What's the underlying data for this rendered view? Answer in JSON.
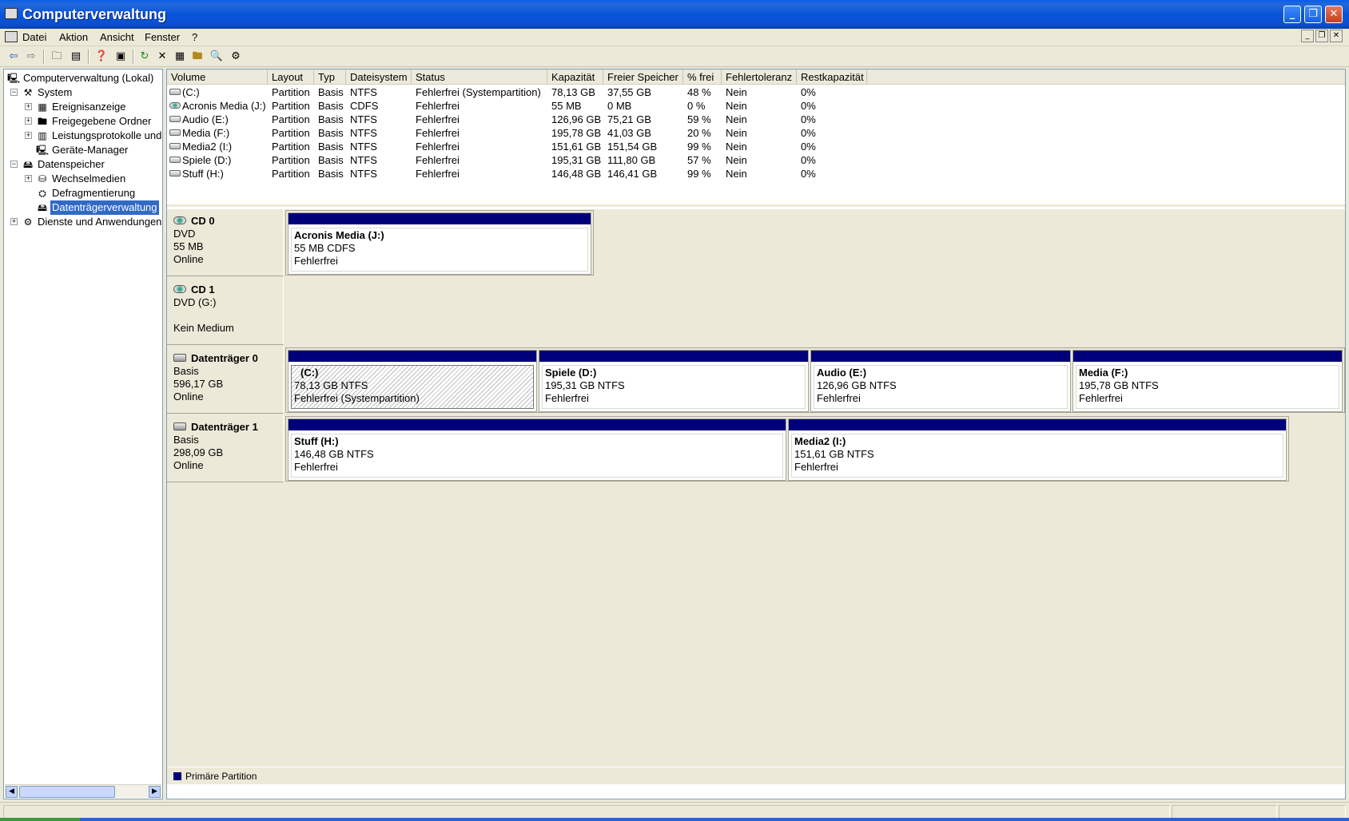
{
  "window": {
    "title": "Computerverwaltung",
    "controls": [
      "_",
      "❐",
      "✕"
    ]
  },
  "menu": {
    "items": [
      "Datei",
      "Aktion",
      "Ansicht",
      "Fenster",
      "?"
    ],
    "mdi_controls": [
      "_",
      "❐",
      "✕"
    ]
  },
  "toolbar": {
    "icons": [
      "back-icon",
      "forward-icon",
      "up-folder-icon",
      "show-hide-tree-icon",
      "properties-icon",
      "help-icon",
      "refresh-icon",
      "delete-icon",
      "properties2-icon",
      "open-icon",
      "search-icon",
      "settings-icon"
    ]
  },
  "tree": {
    "root": "Computerverwaltung (Lokal)",
    "system": "System",
    "ereignisanzeige": "Ereignisanzeige",
    "freigegebene": "Freigegebene Ordner",
    "leistung": "Leistungsprotokolle und",
    "geraete": "Geräte-Manager",
    "datenspeicher": "Datenspeicher",
    "wechselmedien": "Wechselmedien",
    "defrag": "Defragmentierung",
    "datentraeger": "Datenträgerverwaltung",
    "dienste": "Dienste und Anwendungen",
    "expand_plus": "+",
    "expand_minus": "−"
  },
  "list": {
    "columns": [
      "Volume",
      "Layout",
      "Typ",
      "Dateisystem",
      "Status",
      "Kapazität",
      "Freier Speicher",
      "% frei",
      "Fehlertoleranz",
      "Restkapazität"
    ],
    "rows": [
      {
        "volume": "(C:)",
        "layout": "Partition",
        "typ": "Basis",
        "fs": "NTFS",
        "status": "Fehlerfrei (Systempartition)",
        "kap": "78,13 GB",
        "frei": "37,55 GB",
        "pct": "48 %",
        "fehler": "Nein",
        "rest": "0%",
        "icon": "disk"
      },
      {
        "volume": "Acronis Media (J:)",
        "layout": "Partition",
        "typ": "Basis",
        "fs": "CDFS",
        "status": "Fehlerfrei",
        "kap": "55 MB",
        "frei": "0 MB",
        "pct": "0 %",
        "fehler": "Nein",
        "rest": "0%",
        "icon": "cd"
      },
      {
        "volume": "Audio (E:)",
        "layout": "Partition",
        "typ": "Basis",
        "fs": "NTFS",
        "status": "Fehlerfrei",
        "kap": "126,96 GB",
        "frei": "75,21 GB",
        "pct": "59 %",
        "fehler": "Nein",
        "rest": "0%",
        "icon": "disk"
      },
      {
        "volume": "Media (F:)",
        "layout": "Partition",
        "typ": "Basis",
        "fs": "NTFS",
        "status": "Fehlerfrei",
        "kap": "195,78 GB",
        "frei": "41,03 GB",
        "pct": "20 %",
        "fehler": "Nein",
        "rest": "0%",
        "icon": "disk"
      },
      {
        "volume": "Media2 (I:)",
        "layout": "Partition",
        "typ": "Basis",
        "fs": "NTFS",
        "status": "Fehlerfrei",
        "kap": "151,61 GB",
        "frei": "151,54 GB",
        "pct": "99 %",
        "fehler": "Nein",
        "rest": "0%",
        "icon": "disk"
      },
      {
        "volume": "Spiele (D:)",
        "layout": "Partition",
        "typ": "Basis",
        "fs": "NTFS",
        "status": "Fehlerfrei",
        "kap": "195,31 GB",
        "frei": "111,80 GB",
        "pct": "57 %",
        "fehler": "Nein",
        "rest": "0%",
        "icon": "disk"
      },
      {
        "volume": "Stuff (H:)",
        "layout": "Partition",
        "typ": "Basis",
        "fs": "NTFS",
        "status": "Fehlerfrei",
        "kap": "146,48 GB",
        "frei": "146,41 GB",
        "pct": "99 %",
        "fehler": "Nein",
        "rest": "0%",
        "icon": "disk"
      }
    ]
  },
  "disks": [
    {
      "name": "CD 0",
      "type": "DVD",
      "size": "55 MB",
      "state": "Online",
      "partitions": [
        {
          "title": "Acronis Media  (J:)",
          "line2": "55 MB CDFS",
          "line3": "Fehlerfrei"
        }
      ]
    },
    {
      "name": "CD 1",
      "type": "DVD (G:)",
      "size": "",
      "state": "Kein Medium",
      "partitions": []
    },
    {
      "name": "Datenträger 0",
      "type": "Basis",
      "size": "596,17 GB",
      "state": "Online",
      "partitions": [
        {
          "title": "(C:)",
          "line2": "78,13 GB NTFS",
          "line3": "Fehlerfrei (Systempartition)"
        },
        {
          "title": "Spiele  (D:)",
          "line2": "195,31 GB NTFS",
          "line3": "Fehlerfrei"
        },
        {
          "title": "Audio  (E:)",
          "line2": "126,96 GB NTFS",
          "line3": "Fehlerfrei"
        },
        {
          "title": "Media  (F:)",
          "line2": "195,78 GB NTFS",
          "line3": "Fehlerfrei"
        }
      ]
    },
    {
      "name": "Datenträger 1",
      "type": "Basis",
      "size": "298,09 GB",
      "state": "Online",
      "partitions": [
        {
          "title": "Stuff  (H:)",
          "line2": "146,48 GB NTFS",
          "line3": "Fehlerfrei"
        },
        {
          "title": "Media2  (I:)",
          "line2": "151,61 GB NTFS",
          "line3": "Fehlerfrei"
        }
      ]
    }
  ],
  "legend": {
    "label": "Primäre Partition",
    "color": "#00007a"
  }
}
